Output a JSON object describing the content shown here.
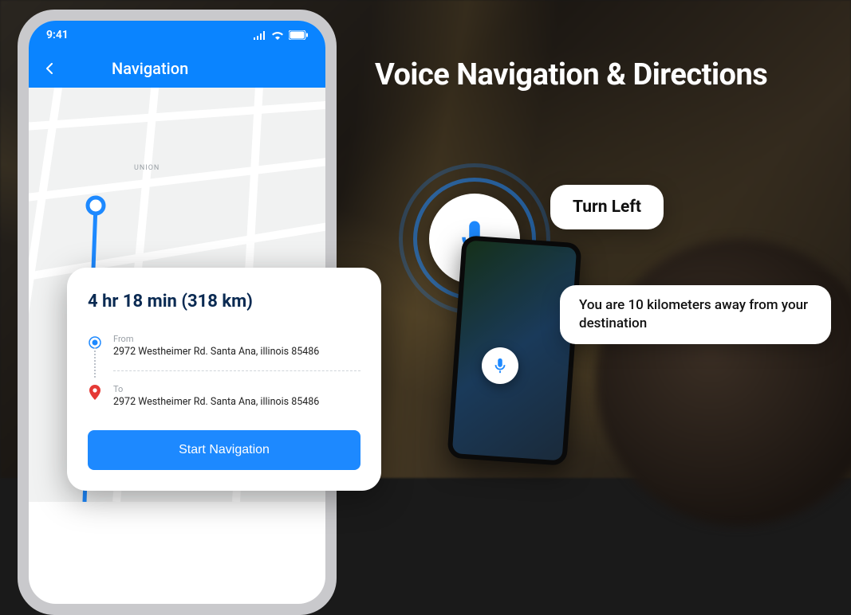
{
  "hero": {
    "title": "Voice Navigation & Directions"
  },
  "status": {
    "time": "9:41"
  },
  "header": {
    "title": "Navigation"
  },
  "map": {
    "neighborhood": "UNION"
  },
  "route": {
    "eta": "4 hr 18 min (318 km)",
    "from_label": "From",
    "from_addr": "2972 Westheimer Rd. Santa Ana, illinois 85486",
    "to_label": "To",
    "to_addr": "2972 Westheimer Rd. Santa Ana, illinois 85486",
    "start_label": "Start Navigation"
  },
  "voice": {
    "bubble1": "Turn Left",
    "bubble2": "You are 10 kilometers away from your destination"
  }
}
